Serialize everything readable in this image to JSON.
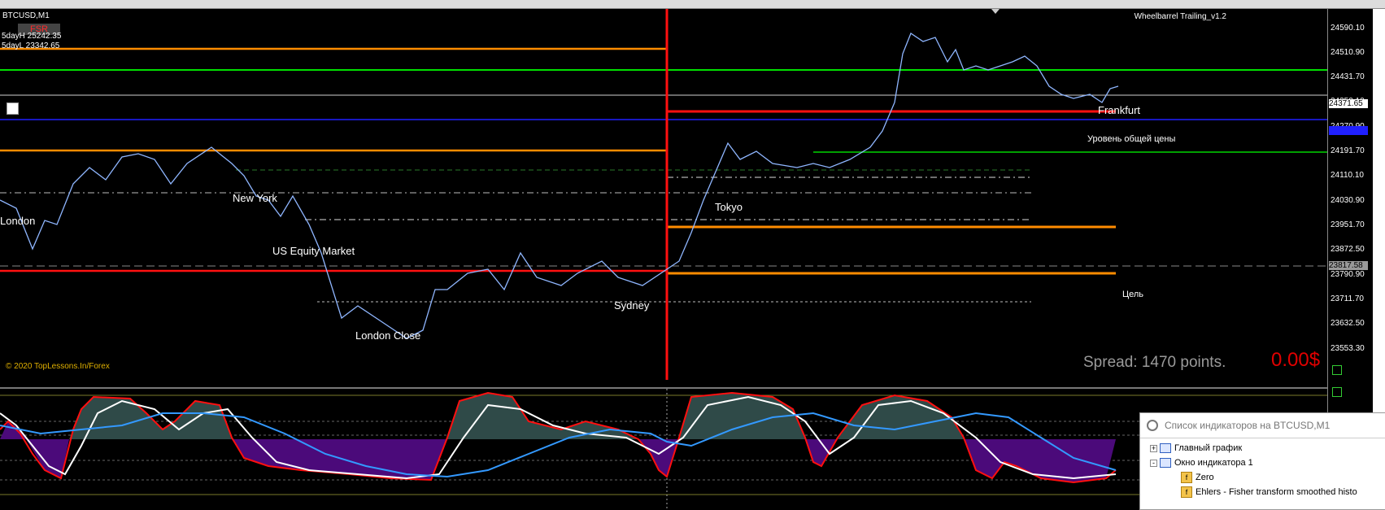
{
  "window": {
    "symbol": "BTCUSD,M1",
    "fsr_badge": "FSR",
    "info_lines": [
      "5dayH 25242.35",
      "5dayL 23342.65"
    ],
    "expert_name": "Wheelbarrel Trailing_v1.2"
  },
  "sessions": {
    "london": "London",
    "new_york": "New York",
    "us_equity": "US Equity Market",
    "london_close": "London Close",
    "sydney": "Sydney",
    "tokyo": "Tokyo",
    "frankfurt": "Frankfurt"
  },
  "annotations": {
    "common_price_level": "Уровень общей цены",
    "target": "Цель",
    "copyright": "© 2020 TopLessons.In/Forex",
    "spread": "Spread: 1470 points.",
    "profit": "0.00$"
  },
  "price_axis": {
    "ticks": [
      "24590.10",
      "24510.90",
      "24431.70",
      "24350.10",
      "24270.90",
      "24191.70",
      "24110.10",
      "24030.90",
      "23951.70",
      "23872.50",
      "23790.90",
      "23711.70",
      "23632.50",
      "23553.30"
    ],
    "current_price": "24371.65",
    "line_price": "23817.58"
  },
  "indicator_panel": {
    "title": "Список индикаторов на BTCUSD,M1",
    "items": [
      {
        "label": "Главный график",
        "level": 0,
        "expander": "+"
      },
      {
        "label": "Окно индикатора 1",
        "level": 0,
        "expander": "-"
      },
      {
        "label": "Zero",
        "level": 1
      },
      {
        "label": "Ehlers - Fisher transform smoothed histo",
        "level": 1
      }
    ]
  },
  "colors": {
    "orange": "#ff8c00",
    "red": "#ff1010",
    "green": "#00c000",
    "bright_green": "#00ff00",
    "blue_line": "#1a1aff",
    "price_line": "#8fb6ff"
  }
}
